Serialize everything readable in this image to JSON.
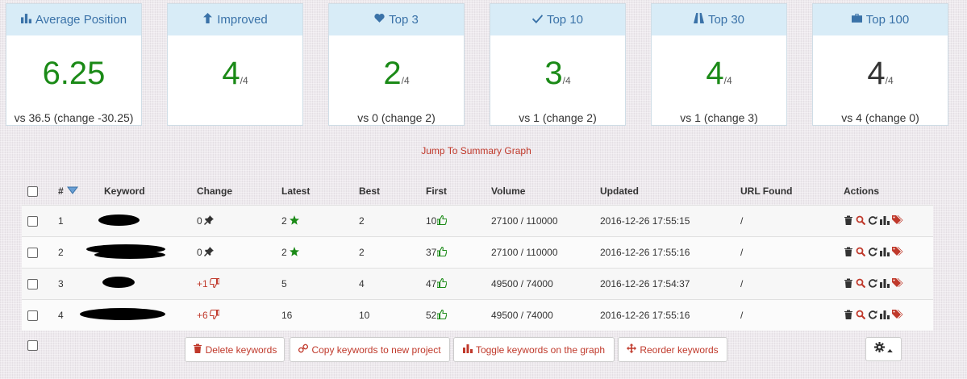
{
  "cards": [
    {
      "title": "Average Position",
      "icon": "bar-chart-icon",
      "value": "6.25",
      "denominator": "",
      "footer": "vs 36.5 (change -30.25)",
      "value_color": "#1b8a17"
    },
    {
      "title": "Improved",
      "icon": "arrow-up-icon",
      "value": "4",
      "denominator": "/4",
      "footer": "",
      "value_color": "#1b8a17"
    },
    {
      "title": "Top 3",
      "icon": "heart-icon",
      "value": "2",
      "denominator": "/4",
      "footer": "vs 0 (change 2)",
      "value_color": "#1b8a17"
    },
    {
      "title": "Top 10",
      "icon": "check-icon",
      "value": "3",
      "denominator": "/4",
      "footer": "vs 1 (change 2)",
      "value_color": "#1b8a17"
    },
    {
      "title": "Top 30",
      "icon": "road-icon",
      "value": "4",
      "denominator": "/4",
      "footer": "vs 1 (change 3)",
      "value_color": "#1b8a17"
    },
    {
      "title": "Top 100",
      "icon": "briefcase-icon",
      "value": "4",
      "denominator": "/4",
      "footer": "vs 4 (change 0)",
      "value_color": "#333333"
    }
  ],
  "jump_link": "Jump To Summary Graph",
  "table": {
    "headers": {
      "num": "#",
      "keyword": "Keyword",
      "change": "Change",
      "latest": "Latest",
      "best": "Best",
      "first": "First",
      "volume": "Volume",
      "updated": "Updated",
      "url": "URL Found",
      "actions": "Actions"
    },
    "rows": [
      {
        "num": "1",
        "change": "0",
        "change_icon": "pin-icon",
        "latest": "2",
        "latest_icon": "star-icon",
        "best": "2",
        "first": "10",
        "first_icon": "thumbs-up-icon",
        "volume": "27100 / 110000",
        "updated": "2016-12-26 17:55:15",
        "url": "/"
      },
      {
        "num": "2",
        "change": "0",
        "change_icon": "pin-icon",
        "latest": "2",
        "latest_icon": "star-icon",
        "best": "2",
        "first": "37",
        "first_icon": "thumbs-up-icon",
        "volume": "27100 / 110000",
        "updated": "2016-12-26 17:55:16",
        "url": "/"
      },
      {
        "num": "3",
        "change": "+1",
        "change_icon": "thumbs-down-icon",
        "latest": "5",
        "latest_icon": "",
        "best": "4",
        "first": "47",
        "first_icon": "thumbs-up-icon",
        "volume": "49500 / 74000",
        "updated": "2016-12-26 17:54:37",
        "url": "/"
      },
      {
        "num": "4",
        "change": "+6",
        "change_icon": "thumbs-down-icon",
        "latest": "16",
        "latest_icon": "",
        "best": "10",
        "first": "52",
        "first_icon": "thumbs-up-icon",
        "volume": "49500 / 74000",
        "updated": "2016-12-26 17:55:16",
        "url": "/"
      }
    ]
  },
  "buttons": {
    "delete": "Delete keywords",
    "copy": "Copy keywords to new project",
    "toggle": "Toggle keywords on the graph",
    "reorder": "Reorder keywords"
  },
  "colors": {
    "accent_green": "#1b8a17",
    "accent_red": "#c0392b",
    "header_blue": "#d8ecf7",
    "header_text": "#3a72a8"
  }
}
